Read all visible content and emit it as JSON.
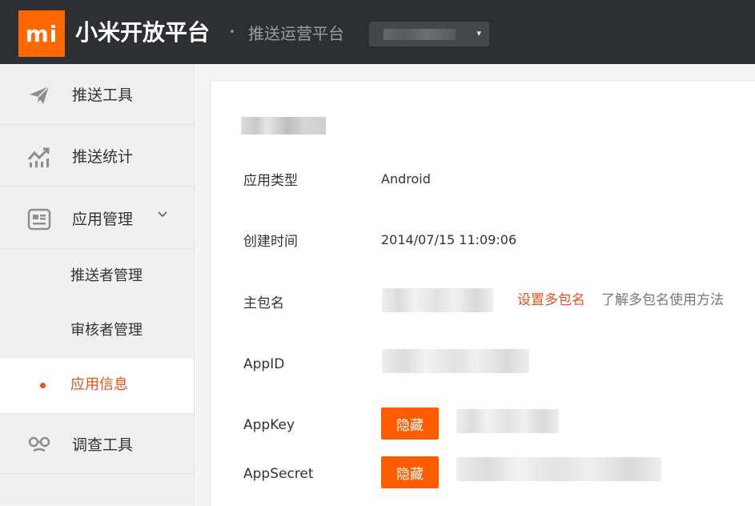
{
  "header": {
    "logo_text": "mi",
    "brand": "小米开放平台",
    "subbrand": "推送运营平台",
    "caret_icon": "▾"
  },
  "sidebar": {
    "items": [
      {
        "label": "推送工具",
        "icon": "paper-plane-icon"
      },
      {
        "label": "推送统计",
        "icon": "trend-chart-icon"
      },
      {
        "label": "应用管理",
        "icon": "app-card-icon",
        "expanded": true
      }
    ],
    "subitems": [
      {
        "label": "推送者管理"
      },
      {
        "label": "审核者管理"
      },
      {
        "label": "应用信息",
        "active": true
      }
    ],
    "items_after": [
      {
        "label": "调查工具",
        "icon": "glasses-icon"
      }
    ],
    "chevron": "⌄"
  },
  "main": {
    "rows": {
      "app_type": {
        "label": "应用类型",
        "value": "Android"
      },
      "created": {
        "label": "创建时间",
        "value": "2014/07/15 11:09:06"
      },
      "package": {
        "label": "主包名"
      },
      "appid": {
        "label": "AppID"
      },
      "appkey": {
        "label": "AppKey",
        "button": "隐藏"
      },
      "appsecret": {
        "label": "AppSecret",
        "button": "隐藏"
      }
    },
    "set_multi_package": "设置多包名",
    "learn_multi_package": "了解多包名使用方法"
  },
  "colors": {
    "accent": "#ff6700",
    "link": "#e8501b",
    "header_bg": "#2d2f33",
    "button": "#ff5c00"
  }
}
